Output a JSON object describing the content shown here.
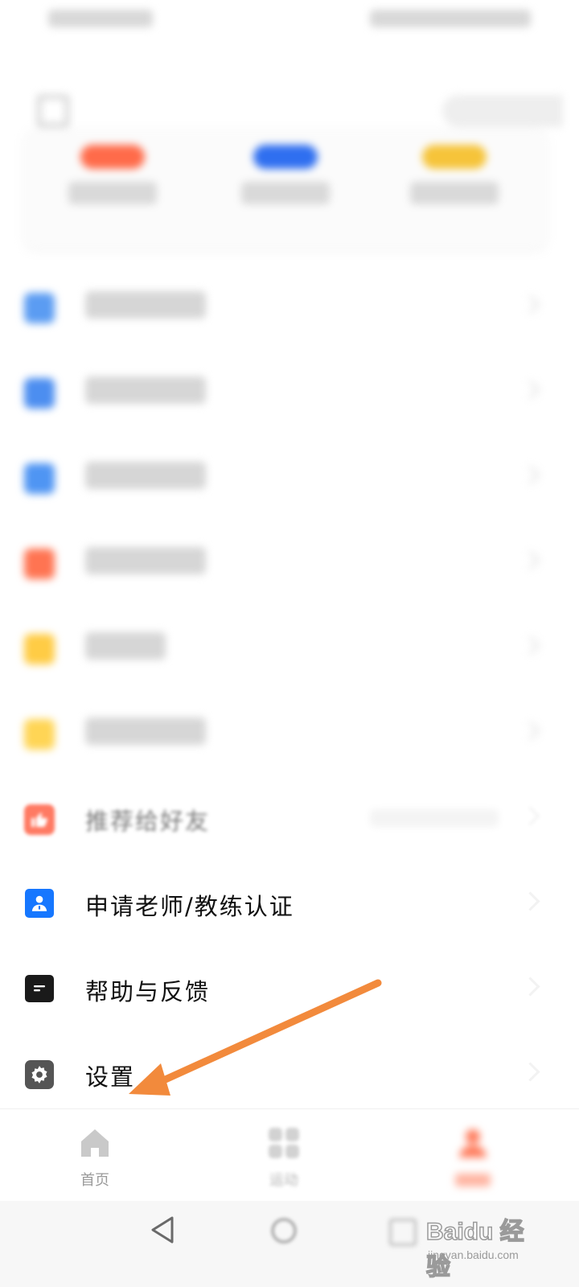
{
  "menu": {
    "recommend_label": "推荐给好友",
    "teacher_label": "申请老师/教练认证",
    "help_label": "帮助与反馈",
    "settings_label": "设置"
  },
  "bottom_nav": {
    "home_label": "首页",
    "sport_label": "运动"
  },
  "watermark": {
    "brand": "Baidu 经验",
    "url": "jingyan.baidu.com"
  },
  "colors": {
    "accent_orange": "#f28a3c",
    "icon_blue": "#1677ff",
    "icon_black": "#1a1a1a",
    "icon_gray": "#555555"
  }
}
